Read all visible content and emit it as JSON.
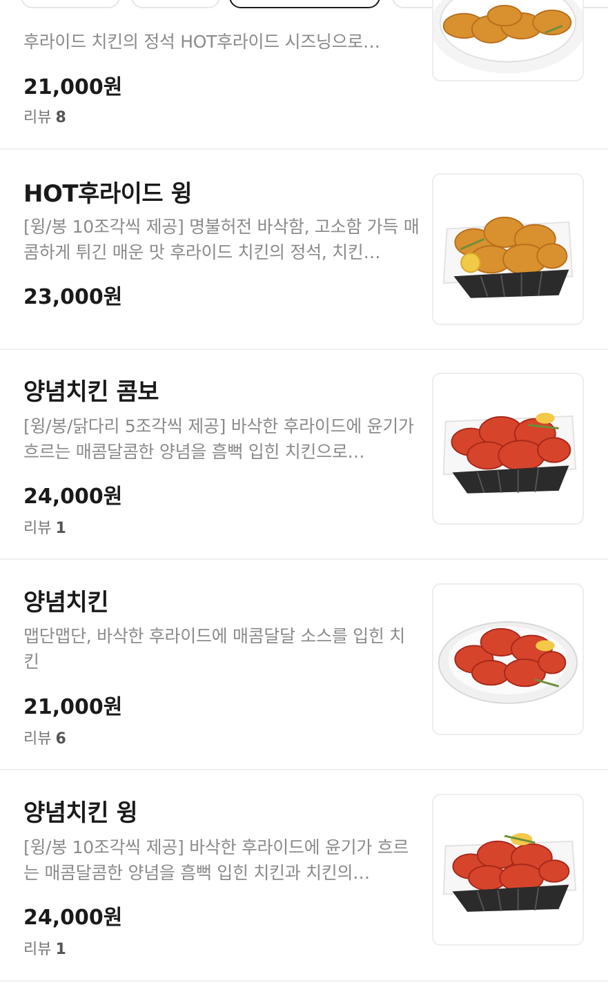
{
  "category_chips": [
    {
      "label": ""
    },
    {
      "label": ""
    },
    {
      "label": "",
      "active": true
    },
    {
      "label": ""
    },
    {
      "label": ""
    }
  ],
  "menu": {
    "items": [
      {
        "name": "",
        "desc": "후라이드 치킨의 정석 HOT후라이드 시즈닝으로…",
        "price": "21,000원",
        "review_label": "리뷰",
        "review_count": "8",
        "image": {
          "icon": "fried-chicken-plate-icon",
          "style": "crispy-plate"
        }
      },
      {
        "name": "HOT후라이드 윙",
        "desc": "[윙/봉 10조각씩 제공] 명불허전 바삭함, 고소함 가득 매콤하게 튀긴 매운 맛 후라이드 치킨의 정석, 치킨…",
        "price": "23,000원",
        "review_label": "",
        "review_count": "",
        "image": {
          "icon": "fried-chicken-basket-icon",
          "style": "crispy-basket"
        }
      },
      {
        "name": "양념치킨 콤보",
        "desc": "[윙/봉/닭다리 5조각씩 제공] 바삭한 후라이드에 윤기가 흐르는 매콤달콤한 양념을 흠뻑 입힌 치킨으로…",
        "price": "24,000원",
        "review_label": "리뷰",
        "review_count": "1",
        "image": {
          "icon": "seasoned-chicken-basket-icon",
          "style": "sauce-basket"
        }
      },
      {
        "name": "양념치킨",
        "desc": "맵단맵단, 바삭한 후라이드에 매콤달달 소스를 입힌 치킨",
        "price": "21,000원",
        "review_label": "리뷰",
        "review_count": "6",
        "image": {
          "icon": "seasoned-chicken-plate-icon",
          "style": "sauce-plate"
        }
      },
      {
        "name": "양념치킨 윙",
        "desc": "[윙/봉 10조각씩 제공] 바삭한 후라이드에 윤기가 흐르는 매콤달콤한 양념을 흠뻑 입힌 치킨과 치킨의…",
        "price": "24,000원",
        "review_label": "리뷰",
        "review_count": "1",
        "image": {
          "icon": "seasoned-chicken-wings-basket-icon",
          "style": "sauce-basket"
        }
      }
    ]
  },
  "colors": {
    "crispy": "#d9902f",
    "crispy_dark": "#b96f1c",
    "sauce": "#d6452b",
    "sauce_dark": "#a8281a",
    "lemon": "#f3c948",
    "basket": "#2b2b2b"
  }
}
